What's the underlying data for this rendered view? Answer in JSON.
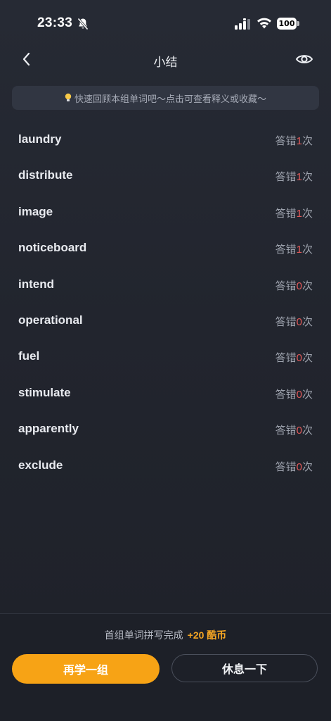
{
  "status_bar": {
    "time": "23:33",
    "battery": "100"
  },
  "header": {
    "title": "小结"
  },
  "tip": {
    "text": "快速回顾本组单词吧～点击可查看释义或收藏～"
  },
  "words": [
    {
      "word": "laundry",
      "prefix": "答错",
      "count": "1",
      "suffix": "次"
    },
    {
      "word": "distribute",
      "prefix": "答错",
      "count": "1",
      "suffix": "次"
    },
    {
      "word": "image",
      "prefix": "答错",
      "count": "1",
      "suffix": "次"
    },
    {
      "word": "noticeboard",
      "prefix": "答错",
      "count": "1",
      "suffix": "次"
    },
    {
      "word": "intend",
      "prefix": "答错",
      "count": "0",
      "suffix": "次"
    },
    {
      "word": "operational",
      "prefix": "答错",
      "count": "0",
      "suffix": "次"
    },
    {
      "word": "fuel",
      "prefix": "答错",
      "count": "0",
      "suffix": "次"
    },
    {
      "word": "stimulate",
      "prefix": "答错",
      "count": "0",
      "suffix": "次"
    },
    {
      "word": "apparently",
      "prefix": "答错",
      "count": "0",
      "suffix": "次"
    },
    {
      "word": "exclude",
      "prefix": "答错",
      "count": "0",
      "suffix": "次"
    }
  ],
  "footer": {
    "reward_text": "首组单词拼写完成",
    "reward_value": "+20 酷币",
    "primary_button": "再学一组",
    "secondary_button": "休息一下"
  },
  "colors": {
    "accent": "#f7a315",
    "error": "#e25a5a",
    "background": "#22252e"
  }
}
